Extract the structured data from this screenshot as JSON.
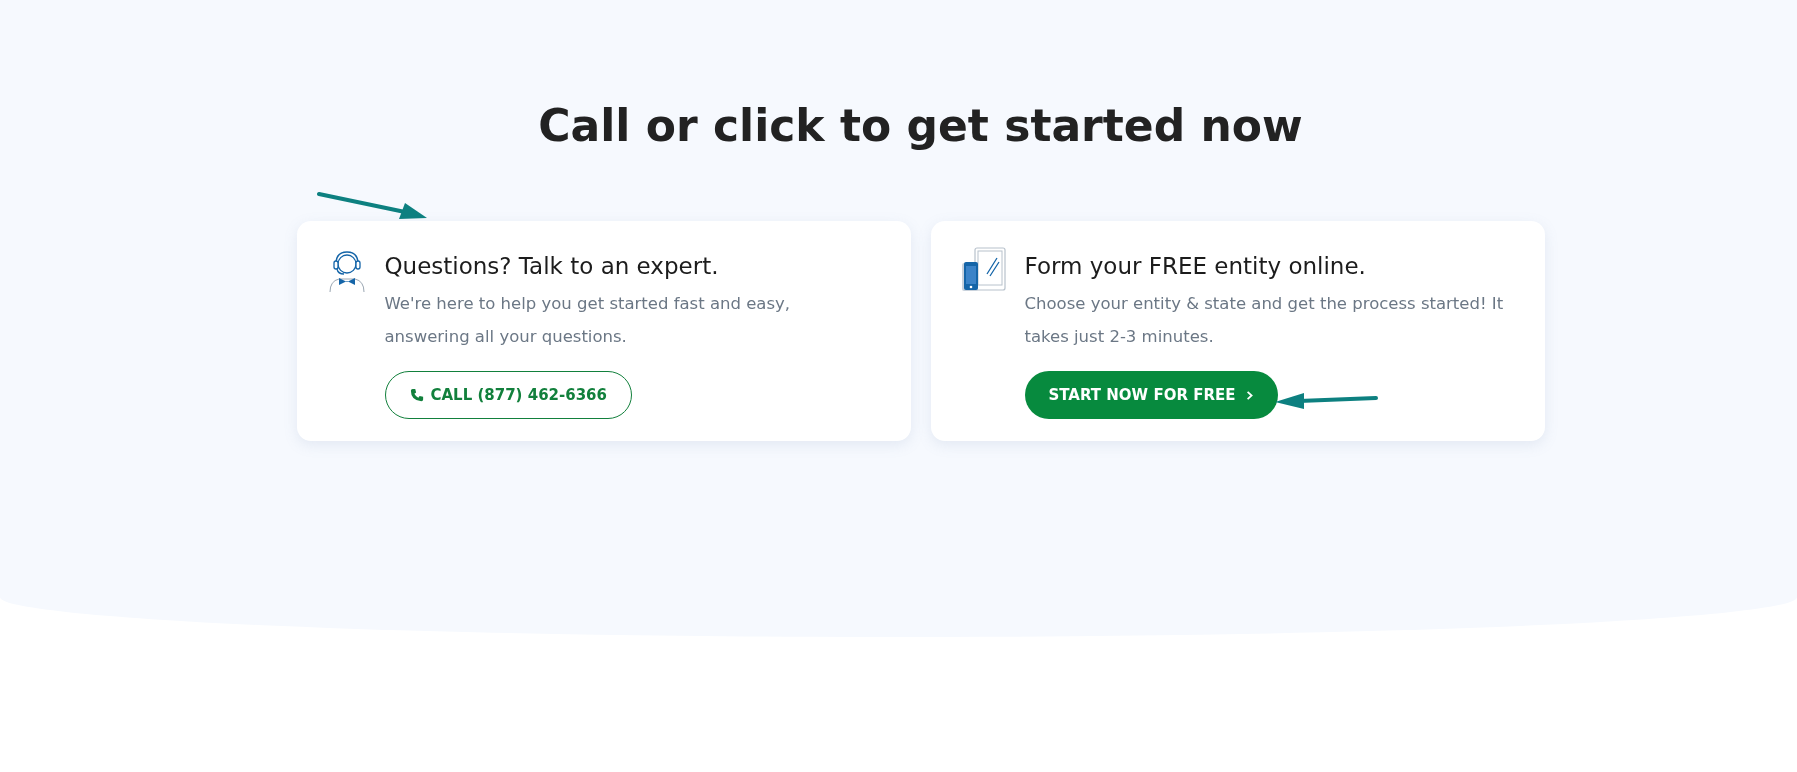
{
  "heading": "Call or click to get started now",
  "cards": [
    {
      "kind": "call",
      "title": "Questions? Talk to an expert.",
      "description": "We're here to help you get started fast and easy, answering all your questions.",
      "button": {
        "kind": "outline",
        "label": "CALL (877) 462-6366"
      }
    },
    {
      "kind": "form",
      "title": "Form your FREE entity online.",
      "description": "Choose your entity & state and get the process started! It takes just 2-3 minutes.",
      "button": {
        "kind": "filled",
        "label": "START NOW FOR FREE"
      }
    }
  ]
}
